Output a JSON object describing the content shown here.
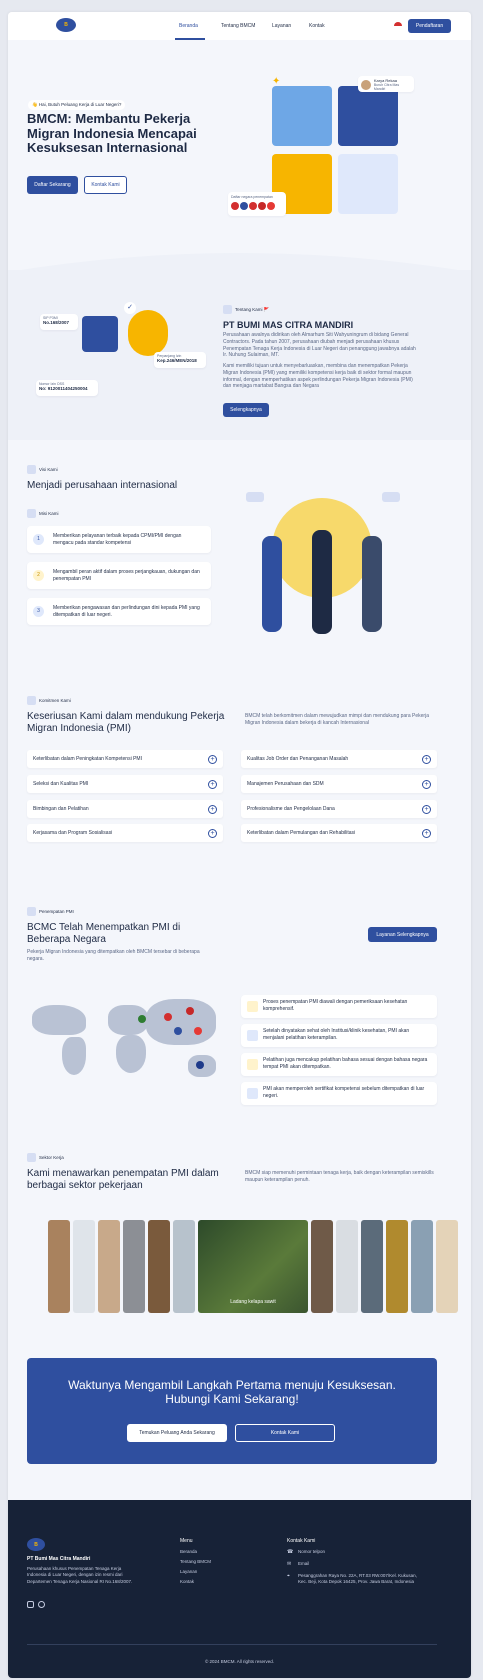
{
  "nav": {
    "links": [
      "Beranda",
      "Tentang BMCM",
      "Layanan",
      "Kontak"
    ],
    "register": "Pendaftaran"
  },
  "hero": {
    "badge": "👋 Hai, Butuh Peluang Kerja di Luar Negeri?",
    "title": "BMCM: Membantu Pekerja Migran Indonesia Mencapai Kesuksesan Internasional",
    "primary": "Daftar Sekarang",
    "secondary": "Kontak Kami",
    "profile_name": "Karya Rekaa",
    "profile_sub": "Buruh Citra Mas Mandiri",
    "registered_label": "Daftar negara penempatan"
  },
  "about": {
    "badge": "Tentang Kami 🚩",
    "title": "PT BUMI MAS CITRA MANDIRI",
    "p1": "Perusahaan awalnya didirikan oleh Almarhum Siti Wahyuningrum di bidang General Contractors. Pada tahun 2007, perusahaan diubah menjadi perusahaan khusus Penempatan Tenaga Kerja Indonesia di Luar Negeri dan penanggung jawabnya adalah Ir. Nuhung Sulaiman, MT.",
    "p2": "Kami memiliki tujuan untuk menyebarluaskan, membina dan menempatkan Pekerja Migran Indonesia (PMI) yang memiliki kompetensi kerja baik di sektor formal maupun informal, dengan memperhatikan aspek perlindungan Pekerja Migran Indonesia (PMI) dan menjaga martabat Bangsa dan Negara",
    "button": "Selengkapnya",
    "sip_label": "SIP P3MI",
    "sip_value": "No.168/2007",
    "kep_label": "Perpanjang Izin",
    "kep_value": "Kep.246/MEN/2018",
    "nib_label": "Nomor Izin OSS",
    "nib_value": "No: 9120011404250004"
  },
  "vision": {
    "badge": "Visi Kami",
    "title": "Menjadi perusahaan internasional",
    "mission_badge": "Misi Kami",
    "missions": [
      {
        "num": "1",
        "text": "Memberikan pelayanan terbaik kepada CPMI/PMI dengan mengacu pada standar kompetensi"
      },
      {
        "num": "2",
        "text": "Mengambil peran aktif dalam proses perjangkauan, dukungan dan penempatan PMI"
      },
      {
        "num": "3",
        "text": "Memberikan pengawasan dan perlindungan dini kepada PMI yang ditempatkan di luar negeri."
      }
    ]
  },
  "commitment": {
    "badge": "Komitmen Kami",
    "title": "Keseriusan Kami dalam mendukung Pekerja Migran Indonesia (PMI)",
    "desc": "BMCM telah berkomitmen dalam mewujudkan mimpi dan mendukung para Pekerja Migran Indonesia dalam bekerja di kancah Internasional",
    "left": [
      "Keterlibatan dalam Peningkatan Kompetensi PMI",
      "Seleksi dan Kualitas PMI",
      "Bimbingan dan Pelatihan",
      "Kerjasama dan Program Sosialisasi"
    ],
    "right": [
      "Kualitas Job Order dan Penanganan Masalah",
      "Manajemen Perusahaan dan SDM",
      "Profesionalisme dan Pengelolaan Dana",
      "Keterlibatan dalam Pemulangan dan Rehabilitasi"
    ]
  },
  "placement": {
    "badge": "Penempatan PMI",
    "title": "BCMC Telah Menempatkan PMI di Beberapa Negara",
    "desc": "Pekerja Migran Indonesia yang ditempatkan oleh BMCM tersebar di beberapa negara.",
    "button": "Layanan Selengkapnya",
    "items": [
      "Proses penempatan PMI diawali dengan pemeriksaan kesehatan komprehensif.",
      "Setelah dinyatakan sehat oleh Institusi/klinik kesehatan, PMI akan menjalani pelatihan keterampilan.",
      "Pelatihan juga mencakup pelatihan bahasa sesuai dengan bahasa negara tempat PMI akan ditempatkan.",
      "PMI akan memperoleh sertifikat kompetensi sebelum ditempatkan di luar negeri."
    ]
  },
  "sectors": {
    "badge": "Sektor Kerja",
    "title": "Kami menawarkan penempatan PMI dalam berbagai sektor pekerjaan",
    "desc": "BMCM siap memenuhi permintaan tenaga kerja, baik dengan keterampilan semiskills maupun keterampilan penuh.",
    "featured_caption": "Ladang kelapa sawit"
  },
  "cta": {
    "title": "Waktunya Mengambil Langkah Pertama menuju Kesuksesan. Hubungi Kami Sekarang!",
    "primary": "Temukan Peluang Anda Sekarang",
    "secondary": "Kontak Kami"
  },
  "footer": {
    "company": "PT Bumi Mas Citra Mandiri",
    "desc": "Perusahaan khusus Penempatan Tenaga Kerja Indonesia di Luar Negeri, dengan izin resmi dari Departemen Tenaga Kerja Nasional RI No.168/2007.",
    "menu_title": "Menu",
    "menu": [
      "Beranda",
      "Tentang BMCM",
      "Layanan",
      "Kontak"
    ],
    "contact_title": "Kontak Kami",
    "phone": "Nomor telpon",
    "email": "Email",
    "address": "Pesanggrahan Raya No. 22A, RT.03 RW.007/Kel. Kukusan, Kec. Beji, Kota Depok 16425, Prov. Jawa Barat, Indonesia",
    "copyright": "© 2024 BMCM. All rights reserved."
  },
  "colors": {
    "primary": "#2f4f9f",
    "dark": "#172237",
    "accent": "#f7b500"
  }
}
